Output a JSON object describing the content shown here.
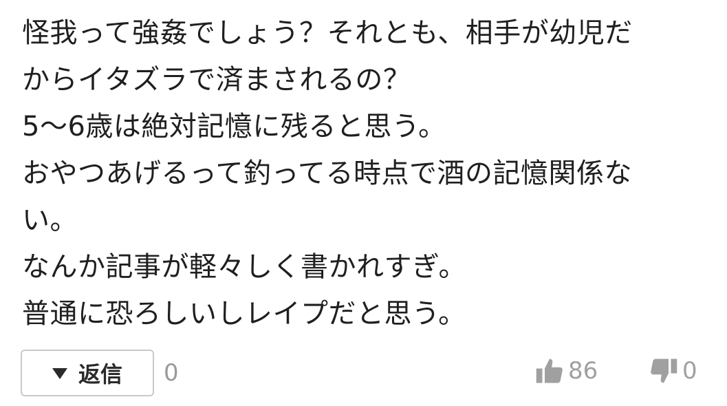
{
  "comment": {
    "lines": [
      "怪我って強姦でしょう？それとも、相手が幼児だ",
      "からイタズラで済まされるの？",
      "5〜6歳は絶対記憶に残ると思う。",
      "おやつあげるって釣ってる時点で酒の記憶関係な",
      "い。",
      "なんか記事が軽々しく書かれすぎ。",
      "普通に恐ろしいしレイプだと思う。"
    ]
  },
  "actions": {
    "reply_label": "返信",
    "reply_count": "0",
    "like_count": "86",
    "dislike_count": "0",
    "icons": {
      "reply": "triangle-down-icon",
      "like": "thumbs-up-icon",
      "dislike": "thumbs-down-icon"
    },
    "icon_color": "#a0a0a0"
  }
}
